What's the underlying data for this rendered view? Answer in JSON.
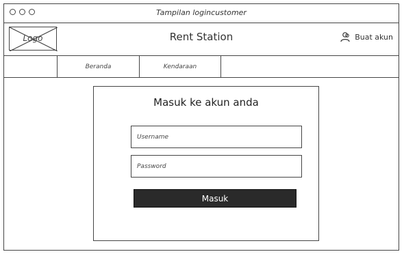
{
  "window": {
    "title": "Tampilan logincustomer"
  },
  "header": {
    "logo_text": "Logo",
    "app_name": "Rent Station",
    "signup_label": "Buat akun",
    "signup_icon": "user-icon"
  },
  "nav": {
    "tabs": [
      {
        "label": "Beranda"
      },
      {
        "label": "Kendaraan"
      }
    ]
  },
  "login": {
    "title": "Masuk ke akun anda",
    "username_placeholder": "Username",
    "password_placeholder": "Password",
    "submit_label": "Masuk"
  },
  "colors": {
    "border": "#444444",
    "button_bg": "#2a2a2a",
    "button_text": "#ffffff"
  }
}
